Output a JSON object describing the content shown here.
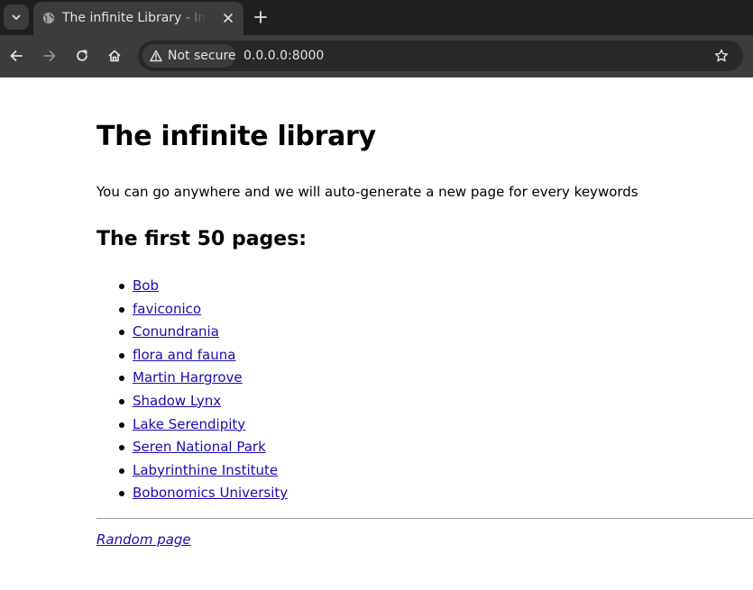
{
  "browser": {
    "tab": {
      "title": "The infinite Library - Infinite library"
    },
    "omnibox": {
      "security_label": "Not secure",
      "url": "0.0.0.0:8000"
    },
    "icons": {
      "tab_menu": "chevron-down-icon",
      "favicon": "globe-icon",
      "close": "close-icon",
      "new_tab": "plus-icon",
      "back": "back-arrow-icon",
      "forward": "forward-arrow-icon",
      "reload": "reload-icon",
      "home": "home-icon",
      "warning": "warning-icon",
      "bookmark": "star-icon"
    }
  },
  "page": {
    "title": "The infinite library",
    "intro": "You can go anywhere and we will auto-generate a new page for every keywords",
    "list_heading": "The first 50 pages:",
    "pages": [
      {
        "label": "Bob"
      },
      {
        "label": "faviconico"
      },
      {
        "label": "Conundrania"
      },
      {
        "label": "flora and fauna"
      },
      {
        "label": "Martin Hargrove"
      },
      {
        "label": "Shadow Lynx"
      },
      {
        "label": "Lake Serendipity"
      },
      {
        "label": "Seren National Park"
      },
      {
        "label": "Labyrinthine Institute"
      },
      {
        "label": "Bobonomics University"
      }
    ],
    "random_link": "Random page"
  },
  "colors": {
    "chrome_dark": "#1f1f1f",
    "chrome_toolbar": "#3c3c3c",
    "omnibox_bg": "#282828",
    "link": "#1a0dab"
  }
}
